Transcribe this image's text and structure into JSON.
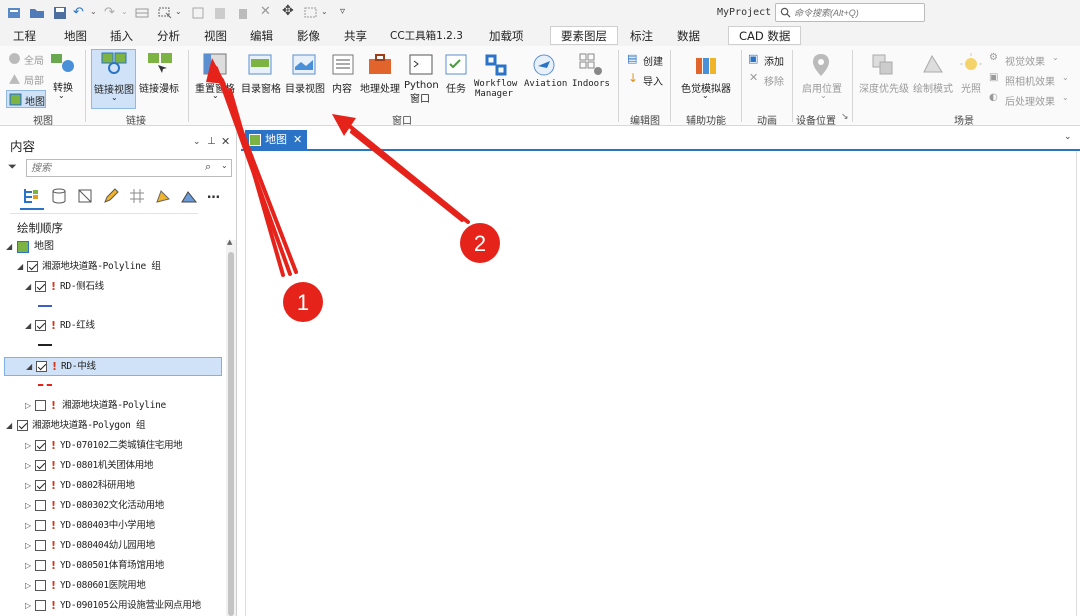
{
  "titlebar": {
    "project_name": "MyProject",
    "search_placeholder": "命令搜索(Alt+Q)"
  },
  "tabs": [
    "工程",
    "地图",
    "插入",
    "分析",
    "视图",
    "编辑",
    "影像",
    "共享",
    "CC工具箱1.2.3",
    "加载项",
    "要素图层",
    "标注",
    "数据",
    "CAD 数据"
  ],
  "active_tab": "视图",
  "ribbon": {
    "view_group": {
      "label": "视图",
      "items": [
        "全局",
        "局部",
        "地图",
        "转换"
      ]
    },
    "link_group": {
      "label": "链接",
      "items": [
        "链接视图",
        "链接漫标"
      ]
    },
    "window_group": {
      "label": "窗口",
      "items": [
        "重置窗格",
        "目录窗格",
        "目录视图",
        "内容",
        "地理处理",
        "Python 窗口",
        "任务",
        "Workflow Manager",
        "Aviation",
        "Indoors"
      ]
    },
    "python_line1": "Python",
    "python_line2": "窗口",
    "workflow_line1": "Workflow",
    "workflow_line2": "Manager",
    "storyboard_group": {
      "label": "编辑图",
      "items": [
        "创建",
        "导入"
      ]
    },
    "aux_group": {
      "label": "辅助功能",
      "items": [
        "色觉模拟器"
      ]
    },
    "anim_group": {
      "label": "动画",
      "items": [
        "添加",
        "移除"
      ]
    },
    "device_group": {
      "label": "设备位置",
      "items": [
        "启用位置"
      ]
    },
    "scene_group": {
      "label": "场景",
      "items": [
        "深度优先级",
        "绘制模式",
        "光照",
        "视觉效果",
        "照相机效果",
        "后处理效果"
      ]
    }
  },
  "contents": {
    "title": "内容",
    "search_placeholder": "搜索",
    "section_title": "绘制顺序",
    "map_name": "地图",
    "group1": "湘源地块道路-Polyline 组",
    "layers1": [
      "RD-侧石线",
      "RD-红线",
      "RD-中线"
    ],
    "layer_poly": "湘源地块道路-Polyline",
    "group2": "湘源地块道路-Polygon 组",
    "layers2": [
      "YD-070102二类城镇住宅用地",
      "YD-0801机关团体用地",
      "YD-0802科研用地",
      "YD-080302文化活动用地",
      "YD-080403中小学用地",
      "YD-080404幼儿园用地",
      "YD-080501体育场馆用地",
      "YD-080601医院用地",
      "YD-090105公用设施营业网点用地"
    ]
  },
  "map_tab": {
    "label": "地图"
  },
  "annotations": [
    "1",
    "2"
  ],
  "colors": {
    "arrow": "#e5231b",
    "accent": "#1a73c9",
    "highlight": "#cfe2f7"
  }
}
